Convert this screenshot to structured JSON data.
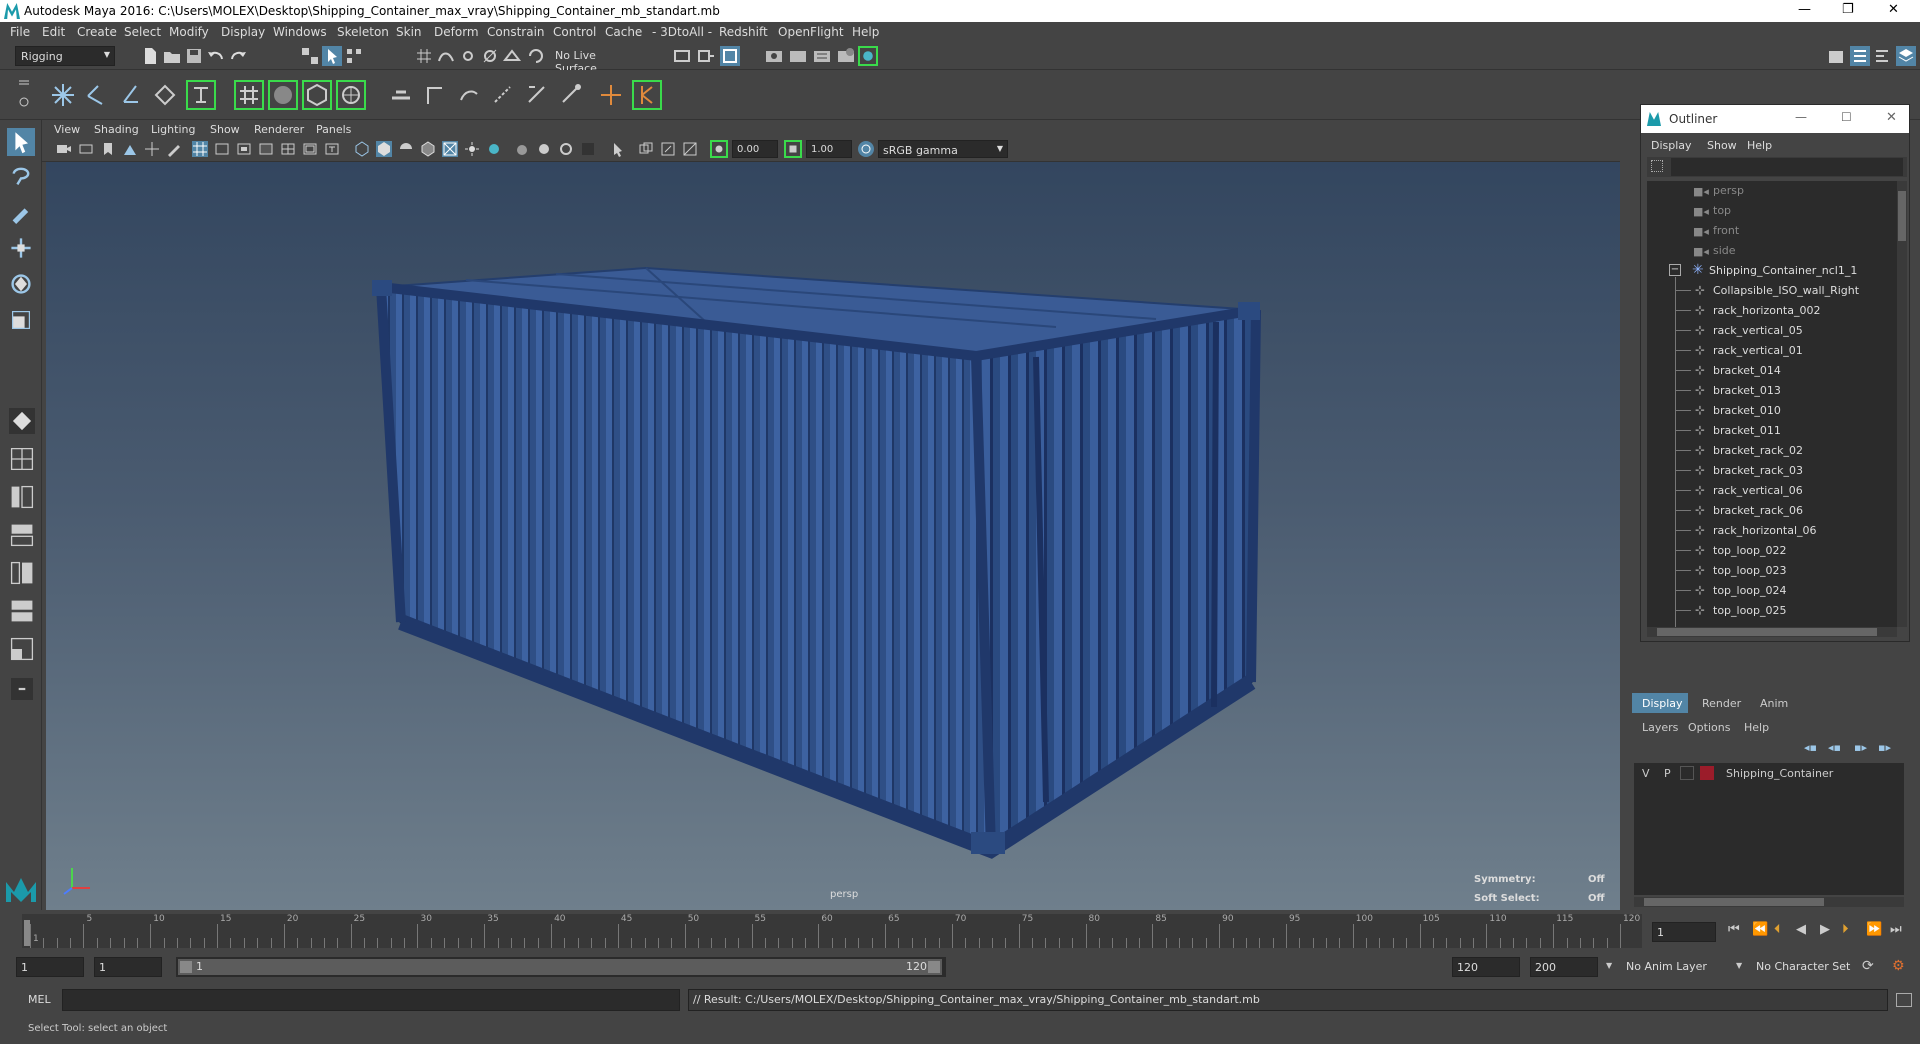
{
  "window": {
    "title": "Autodesk Maya 2016: C:\\Users\\MOLEX\\Desktop\\Shipping_Container_max_vray\\Shipping_Container_mb_standart.mb"
  },
  "menu": [
    "File",
    "Edit",
    "Create",
    "Select",
    "Modify",
    "Display",
    "Windows",
    "Skeleton",
    "Skin",
    "Deform",
    "Constrain",
    "Control",
    "Cache",
    "- 3DtoAll -",
    "Redshift",
    "OpenFlight",
    "Help"
  ],
  "shelf": {
    "mode": "Rigging",
    "live_surface": "No Live Surface"
  },
  "viewport": {
    "menu": [
      "View",
      "Shading",
      "Lighting",
      "Show",
      "Renderer",
      "Panels"
    ],
    "exposure": "0.00",
    "gamma": "1.00",
    "color_space": "sRGB gamma",
    "camera_label": "persp",
    "symmetry_label": "Symmetry:",
    "symmetry_value": "Off",
    "softselect_label": "Soft Select:",
    "softselect_value": "Off"
  },
  "outliner": {
    "title": "Outliner",
    "menu": [
      "Display",
      "Show",
      "Help"
    ],
    "cameras": [
      "persp",
      "top",
      "front",
      "side"
    ],
    "group": "Shipping_Container_ncl1_1",
    "items": [
      "Collapsible_ISO_wall_Right",
      "rack_horizonta_002",
      "rack_vertical_05",
      "rack_vertical_01",
      "bracket_014",
      "bracket_013",
      "bracket_010",
      "bracket_011",
      "bracket_rack_02",
      "bracket_rack_03",
      "rack_vertical_06",
      "bracket_rack_06",
      "rack_horizontal_06",
      "top_loop_022",
      "top_loop_023",
      "top_loop_024",
      "top_loop_025"
    ]
  },
  "layers": {
    "tabs": [
      "Display",
      "Render",
      "Anim"
    ],
    "menu": [
      "Layers",
      "Options",
      "Help"
    ],
    "layer": {
      "v": "V",
      "p": "P",
      "name": "Shipping_Container",
      "color": "#9b1c2a"
    }
  },
  "timeline": {
    "ticks": [
      "1",
      "5",
      "10",
      "15",
      "20",
      "25",
      "30",
      "35",
      "40",
      "45",
      "50",
      "55",
      "60",
      "65",
      "70",
      "75",
      "80",
      "85",
      "90",
      "95",
      "100",
      "105",
      "110",
      "115",
      "120"
    ],
    "current": "1"
  },
  "range": {
    "start": "1",
    "current": "1",
    "slider_start": "1",
    "slider_end": "120",
    "end": "120",
    "max": "200",
    "anim_layer": "No Anim Layer",
    "char_set": "No Character Set"
  },
  "cmd": {
    "label": "MEL",
    "result": "// Result: C:/Users/MOLEX/Desktop/Shipping_Container_max_vray/Shipping_Container_mb_standart.mb"
  },
  "help": {
    "text": "Select Tool: select an object"
  }
}
